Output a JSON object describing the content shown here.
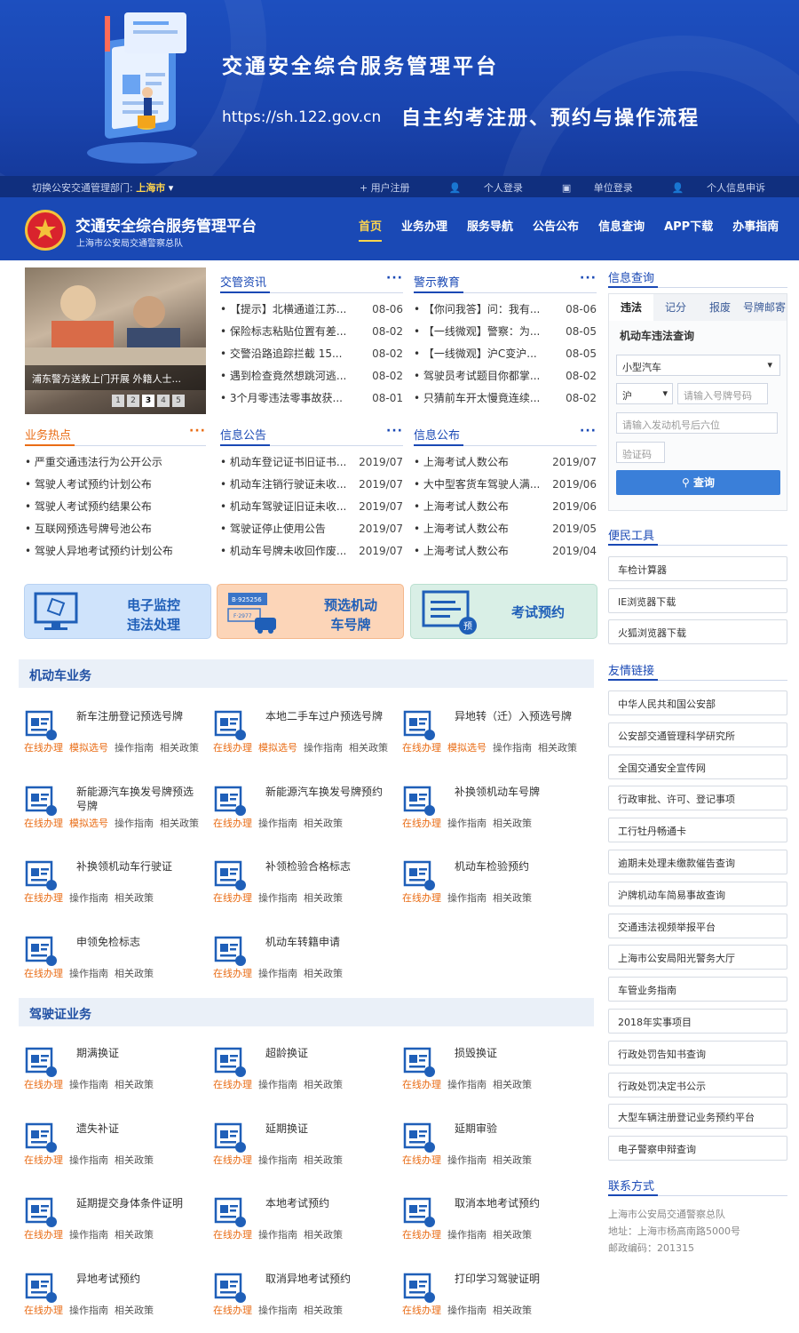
{
  "banner": {
    "title": "交通安全综合服务管理平台",
    "url": "https://sh.122.gov.cn",
    "subtitle": "自主约考注册、预约与操作流程"
  },
  "topbar": {
    "switch_label": "切换公安交通管理部门:",
    "city": "上海市",
    "links": [
      "+ 用户注册",
      "个人登录",
      "单位登录",
      "个人信息申诉"
    ]
  },
  "header": {
    "title": "交通安全综合服务管理平台",
    "subtitle": "上海市公安局交通警察总队",
    "menu": [
      "首页",
      "业务办理",
      "服务导航",
      "公告公布",
      "信息查询",
      "APP下载",
      "办事指南"
    ]
  },
  "carousel": {
    "caption": "浦东警方送救上门开展 外籍人士...",
    "pages": [
      "1",
      "2",
      "3",
      "4",
      "5"
    ],
    "active": 3
  },
  "news1": {
    "title": "交管资讯",
    "more": "···",
    "items": [
      {
        "t": "【提示】北横通道江苏...",
        "d": "08-06"
      },
      {
        "t": "保险标志粘贴位置有差...",
        "d": "08-02"
      },
      {
        "t": "交警沿路追踪拦截 15...",
        "d": "08-02"
      },
      {
        "t": "遇到检查竟然想跳河逃...",
        "d": "08-02"
      },
      {
        "t": "3个月零违法零事故获...",
        "d": "08-01"
      }
    ]
  },
  "news2": {
    "title": "警示教育",
    "more": "···",
    "items": [
      {
        "t": "【你问我答】问：我有...",
        "d": "08-06"
      },
      {
        "t": "【一线微观】警察：为...",
        "d": "08-05"
      },
      {
        "t": "【一线微观】沪C变沪...",
        "d": "08-05"
      },
      {
        "t": "驾驶员考试题目你都掌...",
        "d": "08-02"
      },
      {
        "t": "只猜前车开太慢竟连续...",
        "d": "08-02"
      }
    ]
  },
  "hot": {
    "title": "业务热点",
    "more": "···",
    "items": [
      "严重交通违法行为公开公示",
      "驾驶人考试预约计划公布",
      "驾驶人考试预约结果公布",
      "互联网预选号牌号池公布",
      "驾驶人异地考试预约计划公布"
    ]
  },
  "notice": {
    "title": "信息公告",
    "more": "···",
    "items": [
      {
        "t": "机动车登记证书旧证书...",
        "d": "2019/07"
      },
      {
        "t": "机动车注销行驶证未收...",
        "d": "2019/07"
      },
      {
        "t": "机动车驾驶证旧证未收...",
        "d": "2019/07"
      },
      {
        "t": "驾驶证停止使用公告",
        "d": "2019/07"
      },
      {
        "t": "机动车号牌未收回作废...",
        "d": "2019/07"
      }
    ]
  },
  "publish": {
    "title": "信息公布",
    "more": "···",
    "items": [
      {
        "t": "上海考试人数公布",
        "d": "2019/07"
      },
      {
        "t": "大中型客货车驾驶人满...",
        "d": "2019/06"
      },
      {
        "t": "上海考试人数公布",
        "d": "2019/06"
      },
      {
        "t": "上海考试人数公布",
        "d": "2019/05"
      },
      {
        "t": "上海考试人数公布",
        "d": "2019/04"
      }
    ]
  },
  "tiles": [
    {
      "label": "电子监控\n违法处理"
    },
    {
      "label": "预选机动\n车号牌"
    },
    {
      "label": "考试预约"
    }
  ],
  "vehicle": {
    "title": "机动车业务",
    "items": [
      {
        "name": "新车注册登记预选号牌",
        "ops": [
          "在线办理",
          "模拟选号",
          "操作指南",
          "相关政策"
        ]
      },
      {
        "name": "本地二手车过户预选号牌",
        "ops": [
          "在线办理",
          "模拟选号",
          "操作指南",
          "相关政策"
        ]
      },
      {
        "name": "异地转（迁）入预选号牌",
        "ops": [
          "在线办理",
          "模拟选号",
          "操作指南",
          "相关政策"
        ]
      },
      {
        "name": "新能源汽车换发号牌预选号牌",
        "ops": [
          "在线办理",
          "模拟选号",
          "操作指南",
          "相关政策"
        ]
      },
      {
        "name": "新能源汽车换发号牌预约",
        "ops": [
          "在线办理",
          "操作指南",
          "相关政策"
        ]
      },
      {
        "name": "补换领机动车号牌",
        "ops": [
          "在线办理",
          "操作指南",
          "相关政策"
        ]
      },
      {
        "name": "补换领机动车行驶证",
        "ops": [
          "在线办理",
          "操作指南",
          "相关政策"
        ]
      },
      {
        "name": "补领检验合格标志",
        "ops": [
          "在线办理",
          "操作指南",
          "相关政策"
        ]
      },
      {
        "name": "机动车检验预约",
        "ops": [
          "在线办理",
          "操作指南",
          "相关政策"
        ]
      },
      {
        "name": "申领免检标志",
        "ops": [
          "在线办理",
          "操作指南",
          "相关政策"
        ]
      },
      {
        "name": "机动车转籍申请",
        "ops": [
          "在线办理",
          "操作指南",
          "相关政策"
        ]
      }
    ]
  },
  "license": {
    "title": "驾驶证业务",
    "items": [
      {
        "name": "期满换证",
        "ops": [
          "在线办理",
          "操作指南",
          "相关政策"
        ]
      },
      {
        "name": "超龄换证",
        "ops": [
          "在线办理",
          "操作指南",
          "相关政策"
        ]
      },
      {
        "name": "损毁换证",
        "ops": [
          "在线办理",
          "操作指南",
          "相关政策"
        ]
      },
      {
        "name": "遗失补证",
        "ops": [
          "在线办理",
          "操作指南",
          "相关政策"
        ]
      },
      {
        "name": "延期换证",
        "ops": [
          "在线办理",
          "操作指南",
          "相关政策"
        ]
      },
      {
        "name": "延期审验",
        "ops": [
          "在线办理",
          "操作指南",
          "相关政策"
        ]
      },
      {
        "name": "延期提交身体条件证明",
        "ops": [
          "在线办理",
          "操作指南",
          "相关政策"
        ]
      },
      {
        "name": "本地考试预约",
        "ops": [
          "在线办理",
          "操作指南",
          "相关政策"
        ]
      },
      {
        "name": "取消本地考试预约",
        "ops": [
          "在线办理",
          "操作指南",
          "相关政策"
        ]
      },
      {
        "name": "异地考试预约",
        "ops": [
          "在线办理",
          "操作指南",
          "相关政策"
        ]
      },
      {
        "name": "取消异地考试预约",
        "ops": [
          "在线办理",
          "操作指南",
          "相关政策"
        ]
      },
      {
        "name": "打印学习驾驶证明",
        "ops": [
          "在线办理",
          "操作指南",
          "相关政策"
        ]
      }
    ]
  },
  "query": {
    "title": "信息查询",
    "tabs": [
      "违法",
      "记分",
      "报废",
      "号牌邮寄"
    ],
    "form_title": "机动车违法查询",
    "vehicle_type": "小型汽车",
    "province": "沪",
    "plate_placeholder": "请输入号牌号码",
    "engine_placeholder": "请输入发动机号后六位",
    "captcha_placeholder": "验证码",
    "button": "查询"
  },
  "tools": {
    "title": "便民工具",
    "items": [
      "车检计算器",
      "IE浏览器下载",
      "火狐浏览器下载"
    ]
  },
  "friends": {
    "title": "友情链接",
    "items": [
      "中华人民共和国公安部",
      "公安部交通管理科学研究所",
      "全国交通安全宣传网",
      "行政审批、许可、登记事项",
      "工行牡丹畅通卡",
      "逾期未处理未缴款催告查询",
      "沪牌机动车简易事故查询",
      "交通违法视频举报平台",
      "上海市公安局阳光警务大厅",
      "车管业务指南",
      "2018年实事项目",
      "行政处罚告知书查询",
      "行政处罚决定书公示",
      "大型车辆注册登记业务预约平台",
      "电子警察申辩查询"
    ]
  },
  "contact": {
    "title": "联系方式",
    "org": "上海市公安局交通警察总队",
    "address": "地址：上海市杨高南路5000号",
    "zip": "邮政编码：201315"
  }
}
